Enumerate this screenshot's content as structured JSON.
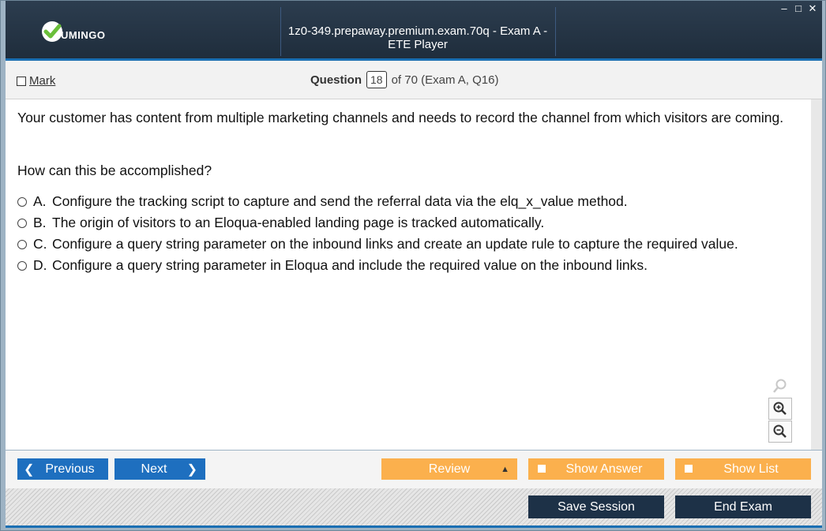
{
  "window": {
    "title": "1z0-349.prepaway.premium.exam.70q - Exam A - ETE Player",
    "logo_text": "UMINGO",
    "controls": [
      "minimize-icon",
      "maximize-icon",
      "close-icon"
    ],
    "colors": {
      "titlebar": "#1f2d3c",
      "accent": "#1a6fb3",
      "brand_green": "#6abf3a"
    }
  },
  "header": {
    "mark_label": "Mark",
    "question_label": "Question",
    "question_number": "18",
    "question_of": "of 70 (Exam A, Q16)"
  },
  "question": {
    "stem": "Your customer has content from multiple marketing channels and needs to record the channel from which visitors are coming.",
    "prompt": "How can this be accomplished?",
    "options": [
      {
        "letter": "A.",
        "text": "Configure the tracking script to capture and send the referral data via the elq_x_value method."
      },
      {
        "letter": "B.",
        "text": "The origin of visitors to an Eloqua-enabled landing page is tracked automatically."
      },
      {
        "letter": "C.",
        "text": "Configure a query string parameter on the inbound links and create an update rule to capture the required value."
      },
      {
        "letter": "D.",
        "text": "Configure a query string parameter in Eloqua and include the required value on the inbound links."
      }
    ]
  },
  "zoom": {
    "icons": [
      "search-icon",
      "zoom-in-icon",
      "zoom-out-icon"
    ]
  },
  "nav": {
    "previous_label": "Previous",
    "next_label": "Next",
    "review_label": "Review",
    "show_answer_label": "Show Answer",
    "show_list_label": "Show List",
    "save_session_label": "Save Session",
    "end_exam_label": "End Exam",
    "colors": {
      "blue": "#1e6fbf",
      "orange": "#fbb04d",
      "dark": "#1d3147"
    }
  }
}
